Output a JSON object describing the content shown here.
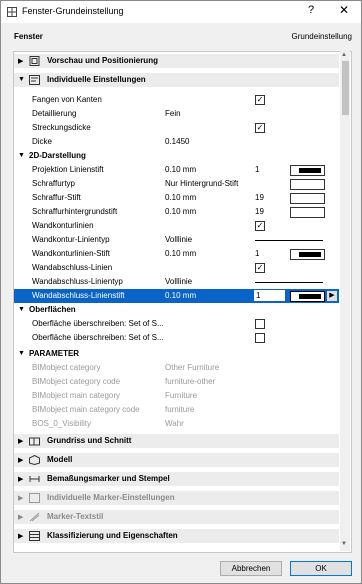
{
  "window": {
    "title": "Fenster-Grundeinstellung",
    "help_glyph": "?",
    "close_glyph": "✕"
  },
  "header": {
    "left": "Fenster",
    "right": "Grundeinstellung"
  },
  "sections": {
    "vorschau": "Vorschau und Positionierung",
    "individuelle": "Individuelle Einstellungen",
    "grundriss": "Grundriss und Schnitt",
    "modell": "Modell",
    "bemassung": "Bemaßungsmarker und Stempel",
    "marker": "Individuelle Marker-Einstellungen",
    "markertext": "Marker-Textstil",
    "klassifizierung": "Klassifizierung und Eigenschaften"
  },
  "groups": {
    "darstellung": "2D-Darstellung",
    "oberflaechen": "Oberflächen",
    "parameter": "PARAMETER"
  },
  "props": {
    "fangen": {
      "label": "Fangen von Kanten"
    },
    "detail": {
      "label": "Detaillierung",
      "value": "Fein"
    },
    "streck": {
      "label": "Streckungsdicke"
    },
    "dicke": {
      "label": "Dicke",
      "value": "0.1450"
    },
    "projektion": {
      "label": "Projektion Linienstift",
      "value": "0.10 mm",
      "num": "1"
    },
    "schrafftyp": {
      "label": "Schraffurtyp",
      "value": "Nur Hintergrund-Stift"
    },
    "schraffstift": {
      "label": "Schraffur-Stift",
      "value": "0.10 mm",
      "num": "19"
    },
    "schraffhg": {
      "label": "Schraffurhintergrundstift",
      "value": "0.10 mm",
      "num": "19"
    },
    "wkontur": {
      "label": "Wandkonturlinien"
    },
    "wkonturtyp": {
      "label": "Wandkontur-Linientyp",
      "value": "Volllinie"
    },
    "wkonturstift": {
      "label": "Wandkonturlinien-Stift",
      "value": "0.10 mm",
      "num": "1"
    },
    "wabschluss": {
      "label": "Wandabschluss-Linien"
    },
    "wabschlusstyp": {
      "label": "Wandabschluss-Linientyp",
      "value": "Volllinie"
    },
    "wabschlussstift": {
      "label": "Wandabschluss-Linienstift",
      "value": "0.10 mm",
      "num": "1"
    },
    "ober1": {
      "label": "Oberfläche überschreiben: Set of S..."
    },
    "ober2": {
      "label": "Oberfläche überschreiben: Set of S..."
    },
    "p1": {
      "label": "BIMobject category",
      "value": "Other Furniture"
    },
    "p2": {
      "label": "BIMobject category code",
      "value": "furniture-other"
    },
    "p3": {
      "label": "BIMobject main category",
      "value": "Furniture"
    },
    "p4": {
      "label": "BIMobject main category code",
      "value": "furniture"
    },
    "p5": {
      "label": "BOS_0_Visibility",
      "value": "Wahr"
    }
  },
  "checks": {
    "fangen": true,
    "streck": true,
    "wkontur": true,
    "wabschluss": true,
    "ober1": false,
    "ober2": false
  },
  "checkmark": "✓",
  "glyphs": {
    "expanded": "▼",
    "collapsed": "▶",
    "more": "▶"
  },
  "buttons": {
    "cancel": "Abbrechen",
    "ok": "OK"
  },
  "colors": {
    "selection": "#0a64c8",
    "accent": "#0078d7"
  }
}
